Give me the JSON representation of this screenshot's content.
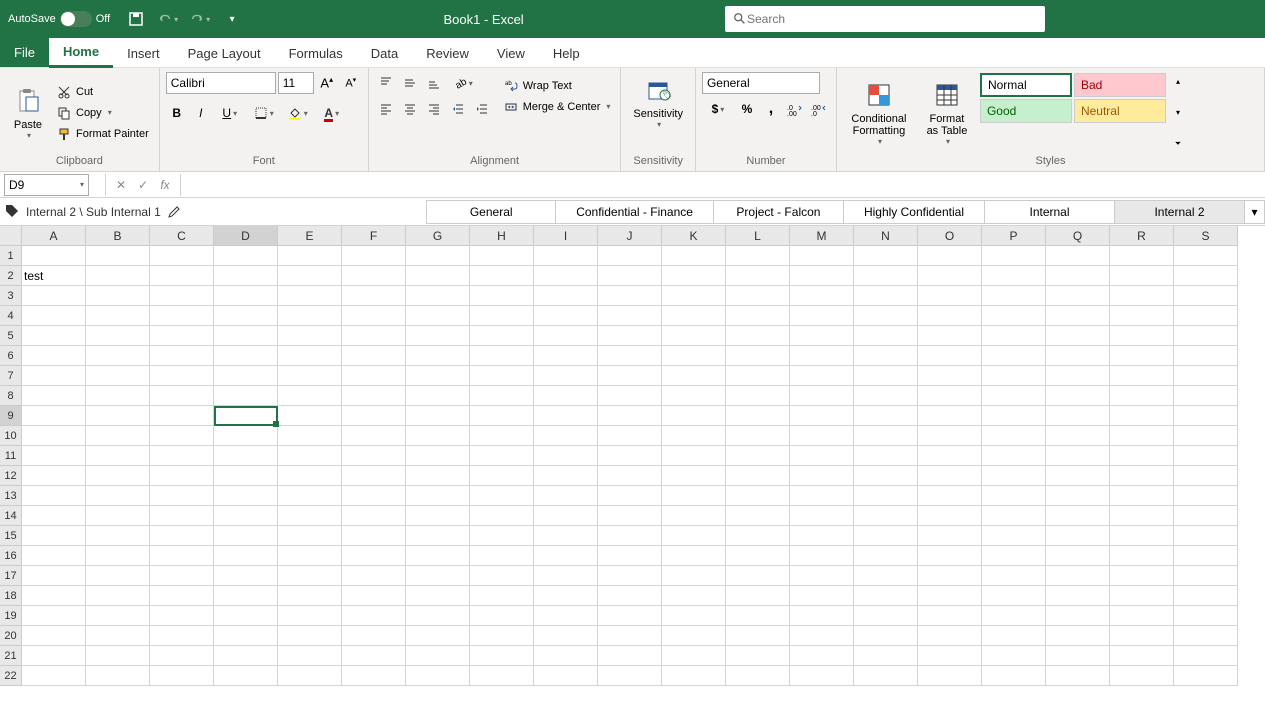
{
  "title_bar": {
    "autosave_label": "AutoSave",
    "autosave_state": "Off",
    "doc_title": "Book1  -  Excel",
    "search_placeholder": "Search"
  },
  "tabs": {
    "file": "File",
    "home": "Home",
    "insert": "Insert",
    "page_layout": "Page Layout",
    "formulas": "Formulas",
    "data": "Data",
    "review": "Review",
    "view": "View",
    "help": "Help"
  },
  "ribbon": {
    "clipboard": {
      "paste": "Paste",
      "cut": "Cut",
      "copy": "Copy",
      "format_painter": "Format Painter",
      "group_label": "Clipboard"
    },
    "font": {
      "name": "Calibri",
      "size": "11",
      "group_label": "Font"
    },
    "alignment": {
      "wrap_text": "Wrap Text",
      "merge_center": "Merge & Center",
      "group_label": "Alignment"
    },
    "sensitivity": {
      "label": "Sensitivity",
      "group_label": "Sensitivity"
    },
    "number": {
      "format": "General",
      "group_label": "Number"
    },
    "styles": {
      "conditional": "Conditional Formatting",
      "format_table": "Format as Table",
      "normal": "Normal",
      "bad": "Bad",
      "good": "Good",
      "neutral": "Neutral",
      "group_label": "Styles"
    }
  },
  "formula_bar": {
    "name_box": "D9",
    "fx": "fx"
  },
  "sensitivity_bar": {
    "current": "Internal 2 \\ Sub Internal 1",
    "options": [
      "General",
      "Confidential - Finance",
      "Project - Falcon",
      "Highly Confidential",
      "Internal",
      "Internal 2"
    ]
  },
  "grid": {
    "columns": [
      "A",
      "B",
      "C",
      "D",
      "E",
      "F",
      "G",
      "H",
      "I",
      "J",
      "K",
      "L",
      "M",
      "N",
      "O",
      "P",
      "Q",
      "R",
      "S"
    ],
    "rows": 22,
    "selected_cell": "D9",
    "data": {
      "A2": "test"
    }
  }
}
